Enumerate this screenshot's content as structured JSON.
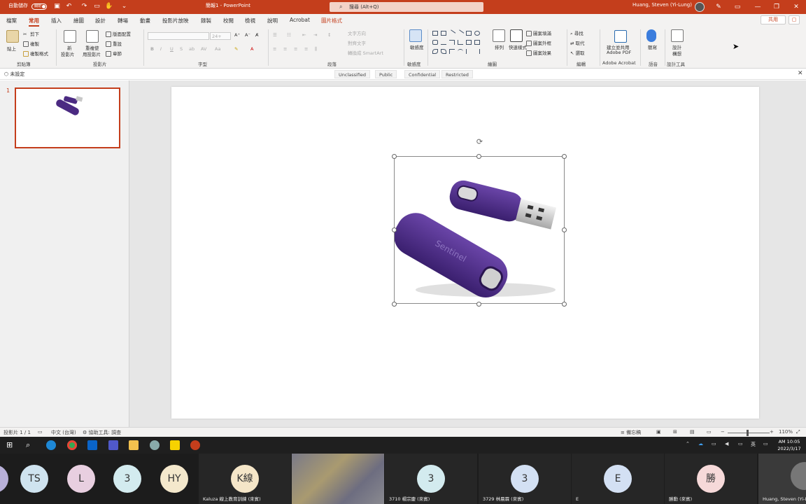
{
  "titlebar": {
    "autosave_label": "自動儲存",
    "autosave_state": "關閉",
    "doc_title": "簡報1 - PowerPoint",
    "search_placeholder": "搜尋 (Alt+Q)",
    "user_name": "Huang, Steven (Yi-Lung)",
    "accent_color": "#c43e1c"
  },
  "tabs": [
    "檔案",
    "常用",
    "插入",
    "繪圖",
    "設計",
    "轉場",
    "動畫",
    "投影片放映",
    "錄製",
    "校閱",
    "檢視",
    "說明",
    "Acrobat",
    "圖片格式"
  ],
  "active_tab": "常用",
  "share_label": "共用",
  "ribbon": {
    "clipboard": {
      "paste": "貼上",
      "cut": "剪下",
      "copy": "複製",
      "format_painter": "複製格式",
      "label": "剪貼簿"
    },
    "slides": {
      "new_slide": "新",
      "new_slide2": "投影片",
      "reuse": "重複使",
      "reuse2": "用投影片",
      "layout": "版面配置",
      "reset": "重設",
      "section": "章節",
      "label": "投影片"
    },
    "font": {
      "label": "字型",
      "size": "24+"
    },
    "paragraph": {
      "text_direction": "文字方向",
      "align_text": "對齊文字",
      "smartart": "轉換成 SmartArt",
      "label": "段落"
    },
    "sensitivity": {
      "btn": "敏感度",
      "label": "敏感度"
    },
    "drawing": {
      "arrange": "排列",
      "quick_styles": "快速樣式",
      "fill": "圖案填滿",
      "outline": "圖案外框",
      "effects": "圖案效果",
      "label": "繪圖"
    },
    "editing": {
      "find": "尋找",
      "replace": "取代",
      "select": "選取",
      "label": "編輯"
    },
    "acrobat": {
      "btn1": "建立並共用",
      "btn2": "Adobe PDF",
      "label": "Adobe Acrobat"
    },
    "voice": {
      "btn": "聽寫",
      "label": "語音"
    },
    "designer": {
      "btn1": "設計",
      "btn2": "構想",
      "label": "設計工具"
    }
  },
  "sensitivity_bar": {
    "label": "未設定",
    "options": [
      "Unclassified",
      "Public",
      "Confidential",
      "Restricted"
    ]
  },
  "slide_panel": {
    "slide_number": "1"
  },
  "statusbar": {
    "slide_info": "投影片 1 / 1",
    "language": "中文 (台灣)",
    "accessibility": "協助工具: 調查",
    "notes": "備忘稿",
    "zoom": "110%"
  },
  "clock": {
    "time": "AM 10:05",
    "date": "2022/3/17"
  },
  "tray": {
    "ime": "英"
  },
  "participants": [
    {
      "initials": "TS",
      "color": "#cfe3ef",
      "name": ""
    },
    {
      "initials": "L",
      "color": "#e8cfe0",
      "name": ""
    },
    {
      "initials": "3",
      "color": "#d3ebef",
      "name": ""
    },
    {
      "initials": "HY",
      "color": "#f4e8cc",
      "name": ""
    },
    {
      "initials": "K線",
      "color": "#f5e6c8",
      "name": "Kaluza 線上教育訓練 (來賓)"
    },
    {
      "initials": "",
      "color": "",
      "name": ""
    },
    {
      "initials": "3",
      "color": "#d3ebef",
      "name": "3710 楊宗慶 (來賓)"
    },
    {
      "initials": "3",
      "color": "#d3e0f3",
      "name": "3729 林晨霖 (來賓)"
    },
    {
      "initials": "E",
      "color": "#d3e0f3",
      "name": "E"
    },
    {
      "initials": "勝",
      "color": "#f6d9d9",
      "name": "勝勳 (來賓)"
    },
    {
      "initials": "",
      "color": "",
      "name": "Huang, Steven (Yi-Lung)"
    }
  ],
  "product_text": "Sentinel"
}
